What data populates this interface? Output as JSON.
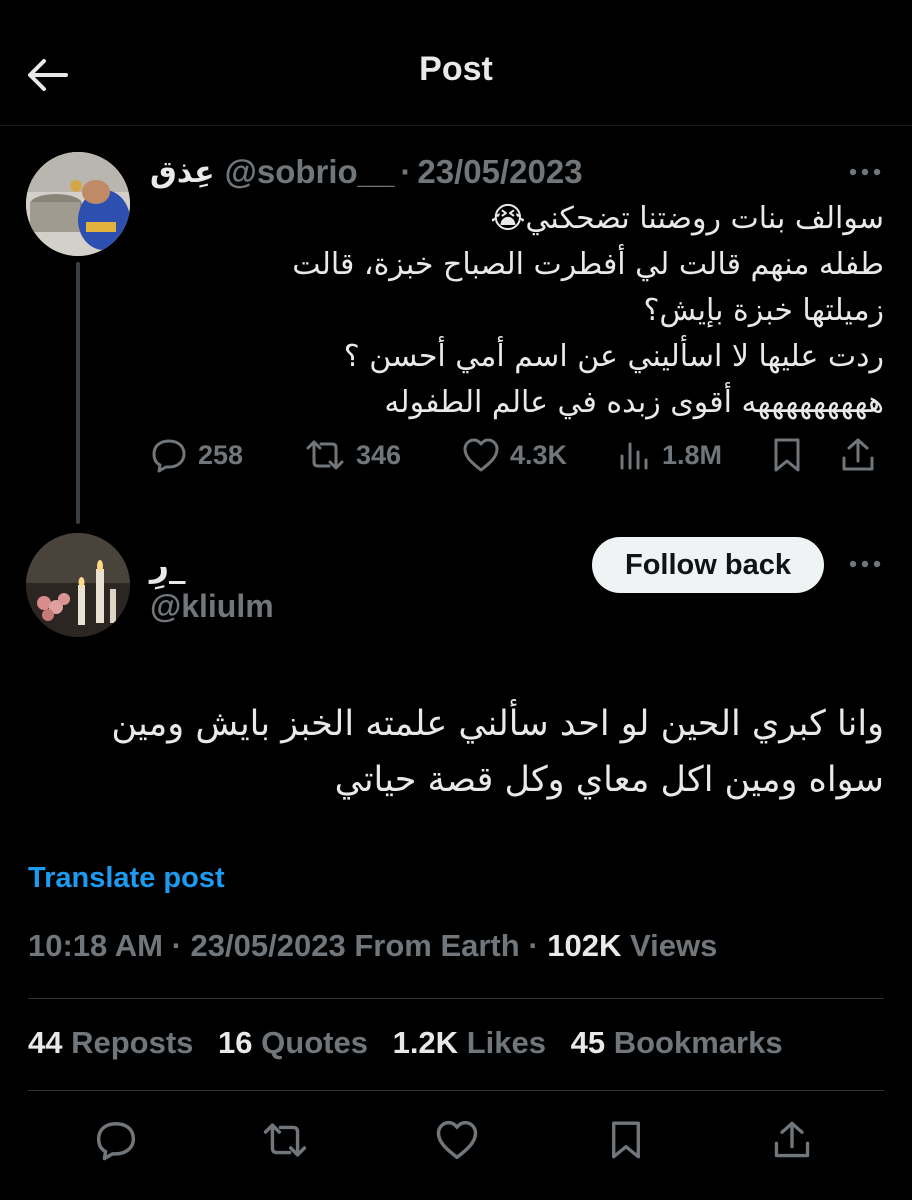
{
  "header": {
    "title": "Post"
  },
  "parent_post": {
    "name": "عِذق",
    "handle": "@sobrio__",
    "separator": "·",
    "date": "23/05/2023",
    "lines": [
      "سوالف بنات روضتنا تضحكني😭",
      "طفله منهم قالت لي أفطرت الصباح خبزة، قالت",
      "زميلتها خبزة بإيش؟",
      "ردت عليها لا اسأليني عن اسم أمي أحسن ؟",
      "هههههههههه أقوى زبده في عالم الطفوله"
    ],
    "replies": "258",
    "reposts": "346",
    "likes": "4.3K",
    "views": "1.8M"
  },
  "reply_post": {
    "name": "رِ_",
    "handle": "@kliulm",
    "follow_label": "Follow back",
    "lines": [
      "وانا كبري الحين لو احد سألني علمته الخبز بايش ومين",
      "سواه ومين اكل معاي وكل قصة حياتي"
    ],
    "translate_label": "Translate post",
    "time": "10:18 AM",
    "separator": "·",
    "date": "23/05/2023",
    "source": "From Earth",
    "views_count": "102K",
    "views_label": "Views",
    "stats": {
      "reposts_count": "44",
      "reposts_label": "Reposts",
      "quotes_count": "16",
      "quotes_label": "Quotes",
      "likes_count": "1.2K",
      "likes_label": "Likes",
      "bookmarks_count": "45",
      "bookmarks_label": "Bookmarks"
    }
  },
  "icons": {
    "back": "arrow-left-icon",
    "more": "more-dots-icon",
    "reply": "speech-bubble-icon",
    "repost": "repost-arrows-icon",
    "like": "heart-icon",
    "views": "bar-chart-icon",
    "bookmark": "bookmark-icon",
    "share": "share-upload-icon"
  },
  "colors": {
    "background": "#000000",
    "text": "#e7e9ea",
    "muted": "#71767b",
    "link": "#1d9bf0"
  }
}
